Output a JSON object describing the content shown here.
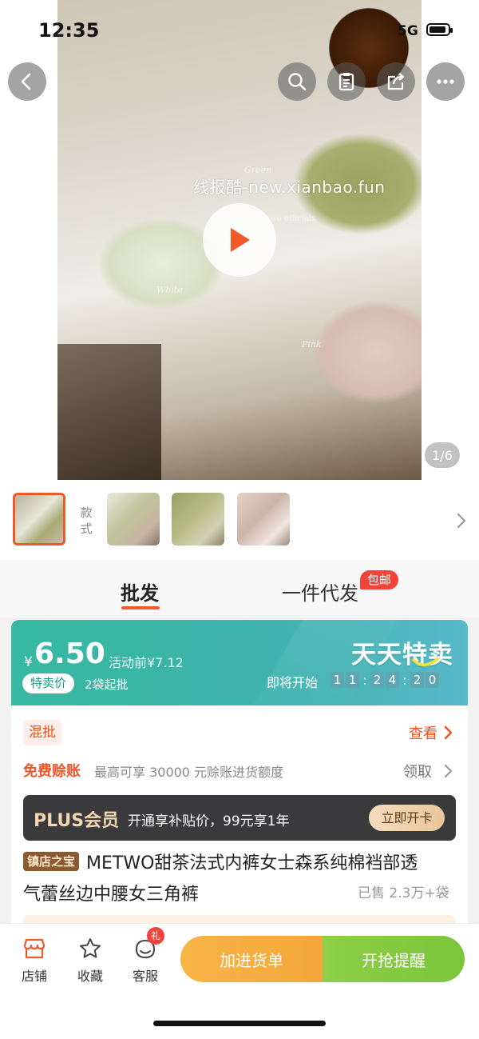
{
  "status_bar": {
    "time": "12:35",
    "network": "5G"
  },
  "hero": {
    "watermark": "线报酷-new.xianbao.fun",
    "photo_labels": {
      "green": "Green",
      "brand": "Metwo officials",
      "white": "White",
      "pink": "Pink"
    },
    "page_counter": "1/6"
  },
  "thumbnails": {
    "style_label": "款式",
    "count": 4,
    "selected_index": 0
  },
  "tabs": {
    "wholesale": "批发",
    "dropship": "一件代发",
    "dropship_badge": "包邮"
  },
  "price_banner": {
    "currency": "¥",
    "price": "6.50",
    "price_before": "活动前¥7.12",
    "tag": "特卖价",
    "min_order": "2袋起批",
    "brand": "天天特卖",
    "status": "即将开始",
    "countdown": {
      "h1": "1",
      "h2": "1",
      "m1": "2",
      "m2": "4",
      "s1": "2",
      "s2": "0"
    }
  },
  "details": {
    "mix_tag": "混批",
    "view": "查看",
    "free_credit_title": "免费赊账",
    "free_credit_desc": "最高可享 30000 元赊账进货额度",
    "claim": "领取",
    "plus": {
      "logo": "PLUS会员",
      "desc": "开通享补贴价，99元享1年",
      "button": "立即开卡"
    },
    "shop_badge": "镇店之宝",
    "title_line1": "METWO甜茶法式内裤女士森系纯棉裆部透",
    "title_line2": "气蕾丝边中腰女三角裤",
    "sold": "已售 2.3万+袋"
  },
  "bottom_bar": {
    "shop": "店铺",
    "favorite": "收藏",
    "service": "客服",
    "gift_badge": "礼",
    "add_to_list": "加进货单",
    "remind": "开抢提醒"
  },
  "colors": {
    "accent": "#f05a28",
    "teal": "#36b8a0",
    "cta_orange": "#f4a73b",
    "cta_green": "#79c63a"
  }
}
